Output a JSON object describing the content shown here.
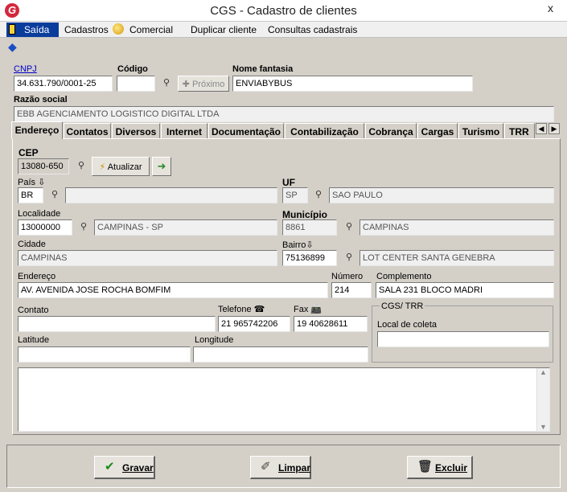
{
  "window": {
    "title": "CGS - Cadastro de clientes",
    "close": "x"
  },
  "menu": {
    "saida": "Saída",
    "cadastros": "Cadastros",
    "comercial": "Comercial",
    "duplicar": "Duplicar cliente",
    "consultas": "Consultas cadastrais"
  },
  "header": {
    "cnpj_label": "CNPJ",
    "cnpj_value": "34.631.790/0001-25",
    "codigo_label": "Código",
    "codigo_value": "",
    "proximo_label": "Próximo",
    "nome_fantasia_label": "Nome fantasia",
    "nome_fantasia_value": "ENVIABYBUS",
    "razao_social_label": "Razão social",
    "razao_social_value": "EBB AGENCIAMENTO LOGISTICO DIGITAL LTDA"
  },
  "tabs": [
    "Endereço",
    "Contatos",
    "Diversos",
    "Internet",
    "Documentação",
    "Contabilização",
    "Cobrança",
    "Cargas",
    "Turismo",
    "TRR"
  ],
  "endereco": {
    "cep_label": "CEP",
    "cep_value": "13080-650",
    "atualizar_label": "Atualizar",
    "pais_label": "País",
    "pais_code": "BR",
    "pais_name": "",
    "uf_label": "UF",
    "uf_code": "SP",
    "uf_name": "SAO PAULO",
    "localidade_label": "Localidade",
    "localidade_code": "13000000",
    "localidade_name": "CAMPINAS - SP",
    "municipio_label": "Município",
    "municipio_code": "8861",
    "municipio_name": "CAMPINAS",
    "cidade_label": "Cidade",
    "cidade_value": "CAMPINAS",
    "bairro_label": "Bairro",
    "bairro_code": "75136899",
    "bairro_name": "LOT CENTER SANTA GENEBRA",
    "endereco_label": "Endereço",
    "endereco_value": "AV. AVENIDA JOSE ROCHA BOMFIM",
    "numero_label": "Número",
    "numero_value": "214",
    "complemento_label": "Complemento",
    "complemento_value": "SALA 231 BLOCO MADRI",
    "contato_label": "Contato",
    "contato_value": "",
    "telefone_label": "Telefone",
    "telefone_value": "21 965742206",
    "fax_label": "Fax",
    "fax_value": "19 40628611",
    "cgs_trr_label": "CGS/ TRR",
    "local_coleta_label": "Local de coleta",
    "local_coleta_value": "",
    "latitude_label": "Latitude",
    "latitude_value": "",
    "longitude_label": "Longitude",
    "longitude_value": ""
  },
  "actions": {
    "gravar": "Gravar",
    "limpar": "Limpar",
    "excluir": "Excluir"
  }
}
